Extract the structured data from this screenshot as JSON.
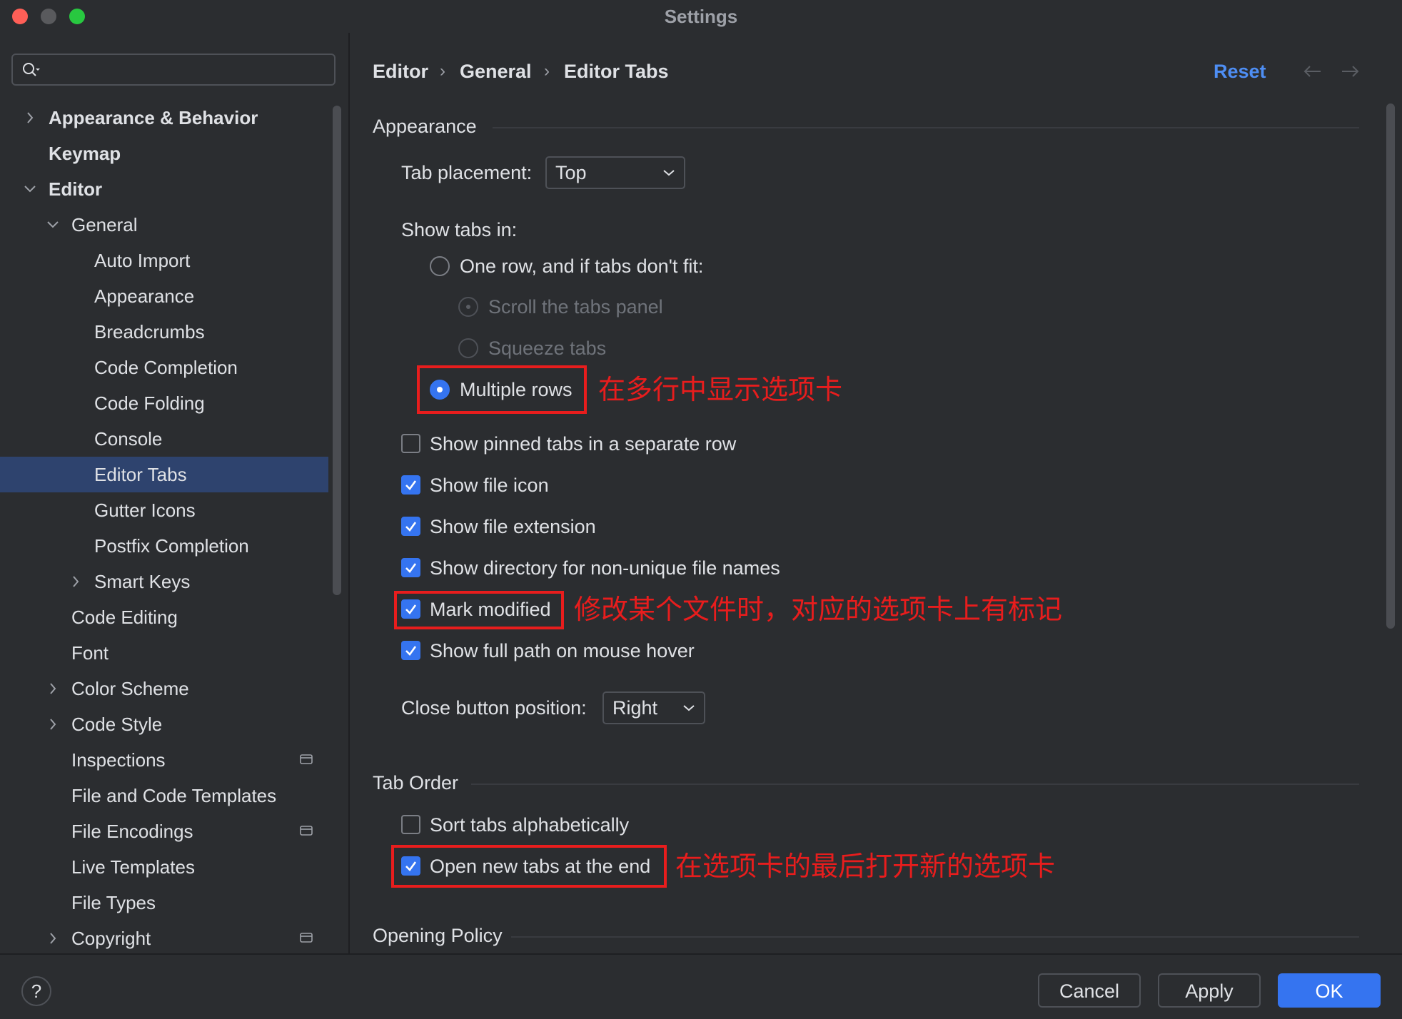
{
  "window": {
    "title": "Settings"
  },
  "search": {
    "placeholder": ""
  },
  "sidebar": {
    "items": [
      {
        "label": "Appearance & Behavior"
      },
      {
        "label": "Keymap"
      },
      {
        "label": "Editor"
      },
      {
        "label": "General"
      },
      {
        "label": "Auto Import"
      },
      {
        "label": "Appearance"
      },
      {
        "label": "Breadcrumbs"
      },
      {
        "label": "Code Completion"
      },
      {
        "label": "Code Folding"
      },
      {
        "label": "Console"
      },
      {
        "label": "Editor Tabs"
      },
      {
        "label": "Gutter Icons"
      },
      {
        "label": "Postfix Completion"
      },
      {
        "label": "Smart Keys"
      },
      {
        "label": "Code Editing"
      },
      {
        "label": "Font"
      },
      {
        "label": "Color Scheme"
      },
      {
        "label": "Code Style"
      },
      {
        "label": "Inspections"
      },
      {
        "label": "File and Code Templates"
      },
      {
        "label": "File Encodings"
      },
      {
        "label": "Live Templates"
      },
      {
        "label": "File Types"
      },
      {
        "label": "Copyright"
      }
    ],
    "selected": "Editor Tabs"
  },
  "breadcrumb": {
    "items": [
      "Editor",
      "General",
      "Editor Tabs"
    ],
    "separator": "›"
  },
  "header": {
    "reset_label": "Reset"
  },
  "appearance": {
    "section_title": "Appearance",
    "tab_placement_label": "Tab placement:",
    "tab_placement_value": "Top",
    "show_tabs_in_label": "Show tabs in:",
    "one_row_label": "One row, and if tabs don't fit:",
    "scroll_label": "Scroll the tabs panel",
    "squeeze_label": "Squeeze tabs",
    "multiple_rows_label": "Multiple rows",
    "pinned_label": "Show pinned tabs in a separate row",
    "file_icon_label": "Show file icon",
    "file_ext_label": "Show file extension",
    "directory_label": "Show directory for non-unique file names",
    "mark_modified_label": "Mark modified",
    "full_path_label": "Show full path on mouse hover",
    "close_button_label": "Close button position:",
    "close_button_value": "Right"
  },
  "tab_order": {
    "section_title": "Tab Order",
    "sort_label": "Sort tabs alphabetically",
    "open_end_label": "Open new tabs at the end"
  },
  "opening_policy": {
    "section_title": "Opening Policy"
  },
  "annotations": {
    "multiple_rows": "在多行中显示选项卡",
    "mark_modified": "修改某个文件时，对应的选项卡上有标记",
    "open_end": "在选项卡的最后打开新的选项卡"
  },
  "footer": {
    "help_label": "?",
    "cancel_label": "Cancel",
    "apply_label": "Apply",
    "ok_label": "OK"
  },
  "colors": {
    "background": "#2b2d30",
    "accent": "#3574f0",
    "selection": "#2e436e",
    "link": "#4e8ef4",
    "annotation": "#e81d1d"
  }
}
